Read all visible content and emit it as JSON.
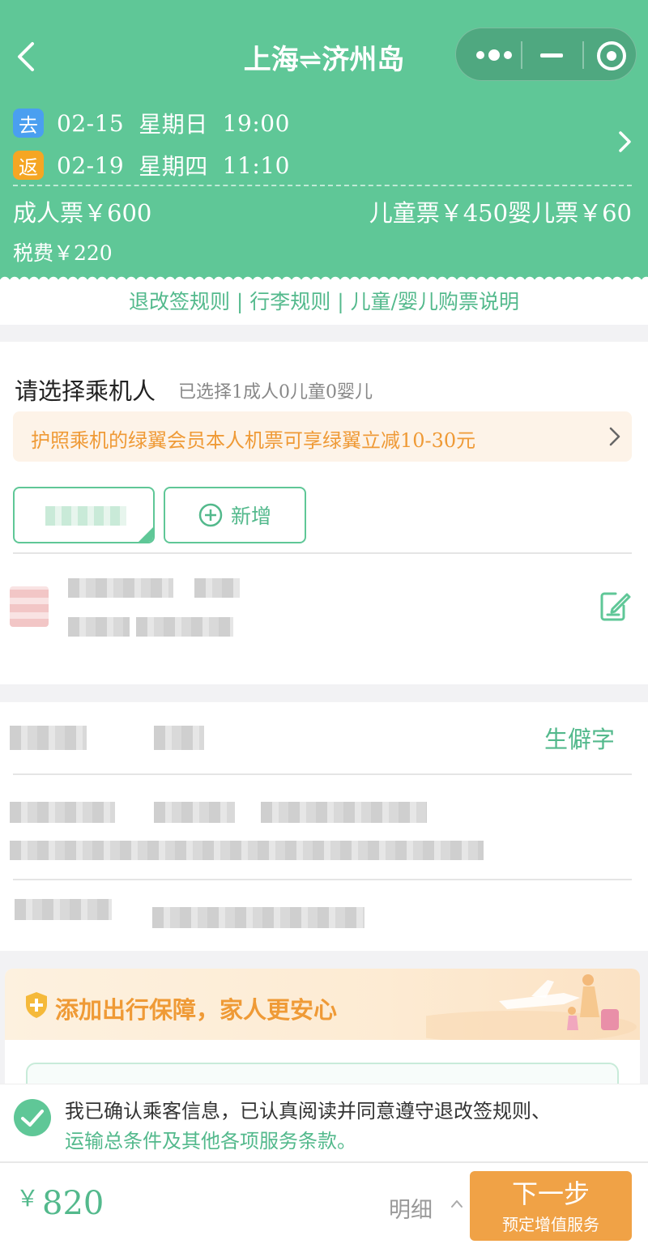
{
  "header": {
    "title": "上海⇌济州岛",
    "outbound": {
      "tag": "去",
      "date": "02-15",
      "weekday": "星期日",
      "time": "19:00"
    },
    "return": {
      "tag": "返",
      "date": "02-19",
      "weekday": "星期四",
      "time": "11:10"
    },
    "adult_price": "成人票￥600",
    "child_infant_price": "儿童票￥450婴儿票￥60",
    "tax": "税费￥220"
  },
  "rules_links": "退改签规则 | 行李规则 | 儿童/婴儿购票说明",
  "passenger": {
    "title": "请选择乘机人",
    "selected_summary": "已选择1成人0儿童0婴儿",
    "promo": "护照乘机的绿翼会员本人机票可享绿翼立减10-30元",
    "add_label": "新增",
    "rare_char_link": "生僻字"
  },
  "protection": {
    "title": "添加出行保障，家人更安心"
  },
  "agreement": {
    "line1": "我已确认乘客信息，已认真阅读并同意遵守退改签规则、",
    "line2": "运输总条件及其他各项服务条款。"
  },
  "footer": {
    "currency": "￥",
    "total": "820",
    "detail_label": "明细",
    "next_label": "下一步",
    "next_sub": "预定增值服务"
  },
  "colors": {
    "brand_green": "#5fc797",
    "accent_orange": "#f0a246"
  },
  "icons": [
    "back-arrow-icon",
    "more-dots-icon",
    "minimize-icon",
    "close-target-icon",
    "chevron-right-icon",
    "plus-circle-icon",
    "edit-icon",
    "shield-plus-icon",
    "check-circle-icon",
    "chevron-up-icon"
  ]
}
